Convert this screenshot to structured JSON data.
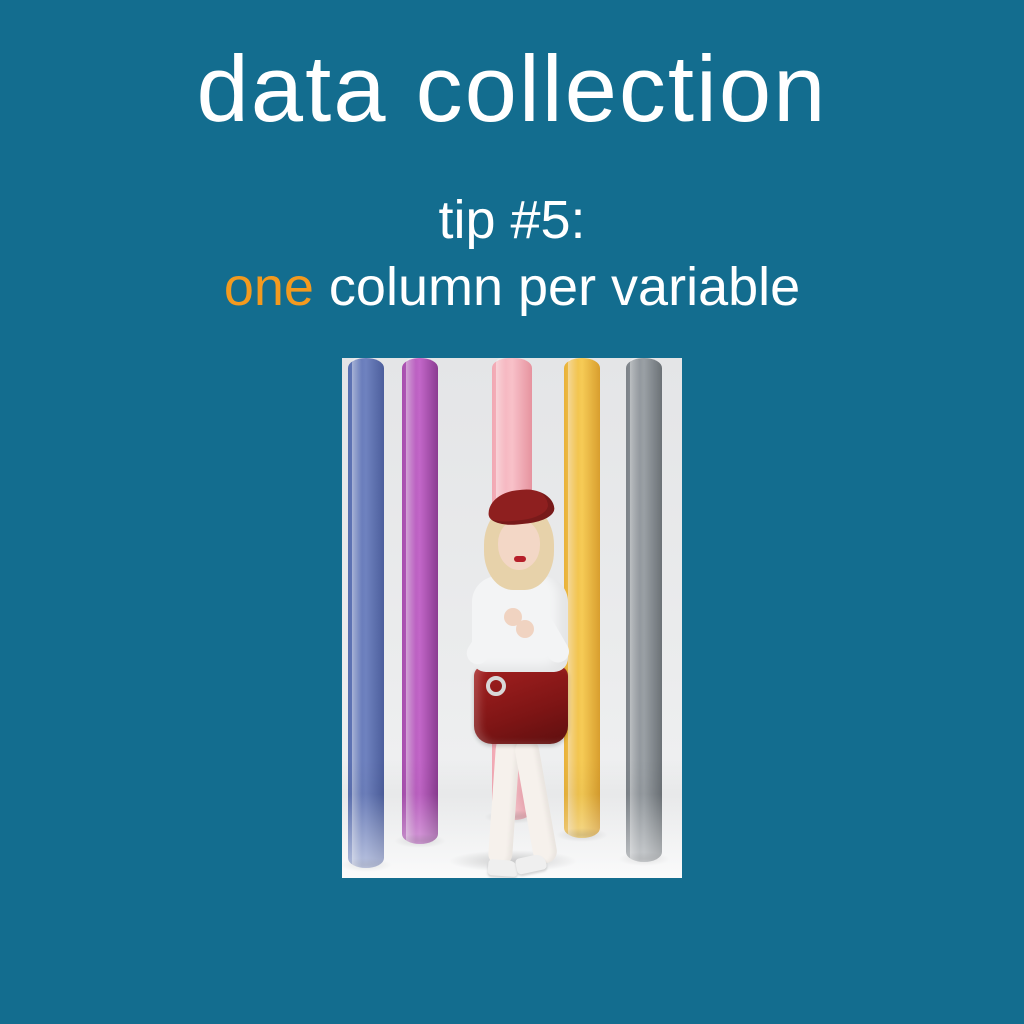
{
  "title": "data collection",
  "subtitle": {
    "line1": "tip #5:",
    "accent": "one",
    "rest": " column per variable"
  },
  "colors": {
    "background": "#136d8f",
    "accent": "#f39a1f",
    "text": "#ffffff"
  },
  "illustration": {
    "description": "person in red beret, white t-shirt, red leather skirt and white tights leaning on colored vertical poles",
    "pole_colors": [
      "blue",
      "purple",
      "pink",
      "yellow",
      "gray"
    ]
  }
}
